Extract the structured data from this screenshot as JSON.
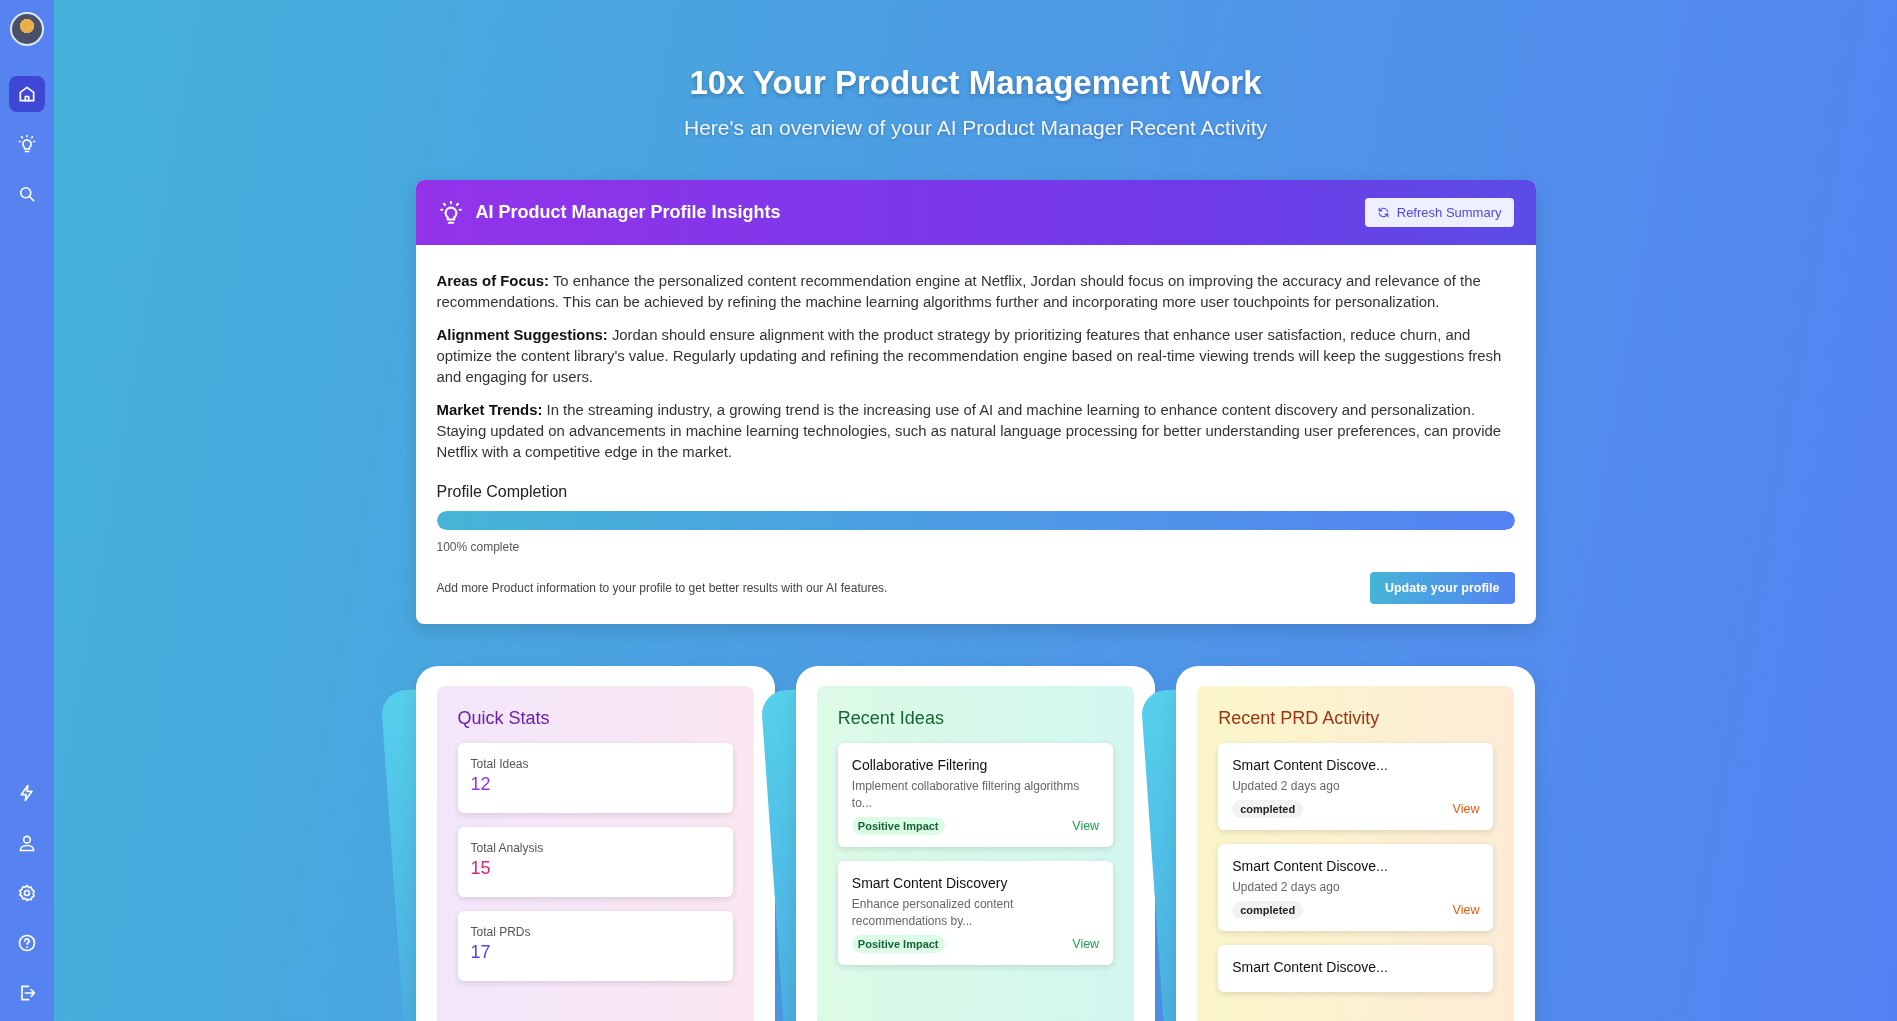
{
  "sidebar": {
    "top_items": [
      {
        "selected": true
      },
      {
        "selected": false
      },
      {
        "selected": false
      }
    ],
    "bottom_items": [
      {
        "selected": false
      },
      {
        "selected": false
      },
      {
        "selected": false
      },
      {
        "selected": false
      },
      {
        "selected": false
      }
    ]
  },
  "hero": {
    "title": "10x Your Product Management Work",
    "subtitle": "Here's an overview of your AI Product Manager Recent Activity"
  },
  "insights": {
    "title": "AI Product Manager Profile Insights",
    "refresh_button": "Refresh Summary",
    "paragraphs": [
      "**Areas of Focus:** To enhance the personalized content recommendation engine at Netflix, Jordan should focus on improving the accuracy and relevance of the recommendations. This can be achieved by refining the machine learning algorithms further and incorporating more user touchpoints for personalization.",
      "**Alignment Suggestions:** Jordan should ensure alignment with the product strategy by prioritizing features that enhance user satisfaction, reduce churn, and optimize the content library's value. Regularly updating and refining the recommendation engine based on real-time viewing trends will keep the suggestions fresh and engaging for users.",
      "**Market Trends:** In the streaming industry, a growing trend is the increasing use of AI and machine learning to enhance content discovery and personalization. Staying updated on advancements in machine learning technologies, such as natural language processing for better understanding user preferences, can provide Netflix with a competitive edge in the market."
    ],
    "completion": {
      "label": "Profile Completion",
      "level": 1,
      "reading": "100% complete"
    },
    "hint": "Add more Product information to your profile to get better results with our AI features.",
    "update_button": "Update your profile"
  },
  "quick_stats": {
    "title": "Quick Stats",
    "stats": [
      {
        "label": "Total Ideas",
        "value": "12",
        "color": "#9333ea"
      },
      {
        "label": "Total Analysis",
        "value": "15",
        "color": "#db2777"
      },
      {
        "label": "Total PRDs",
        "value": "17",
        "color": "#4f46e5"
      }
    ]
  },
  "recent_ideas": {
    "title": "Recent Ideas",
    "ideas": [
      {
        "title": "Collaborative Filtering",
        "description": "Implement collaborative filtering algorithms to...",
        "tag": "Positive Impact",
        "link": "View"
      },
      {
        "title": "Smart Content Discovery",
        "description": "Enhance personalized content recommendations by...",
        "tag": "Positive Impact",
        "link": "View"
      }
    ]
  },
  "recent_prds": {
    "title": "Recent PRD Activity",
    "items": [
      {
        "title": "Smart Content Discove...",
        "updated": "Updated 2 days ago",
        "status": "completed",
        "link": "View"
      },
      {
        "title": "Smart Content Discove...",
        "updated": "Updated 2 days ago",
        "status": "completed",
        "link": "View"
      },
      {
        "title": "Smart Content Discove..."
      }
    ]
  }
}
